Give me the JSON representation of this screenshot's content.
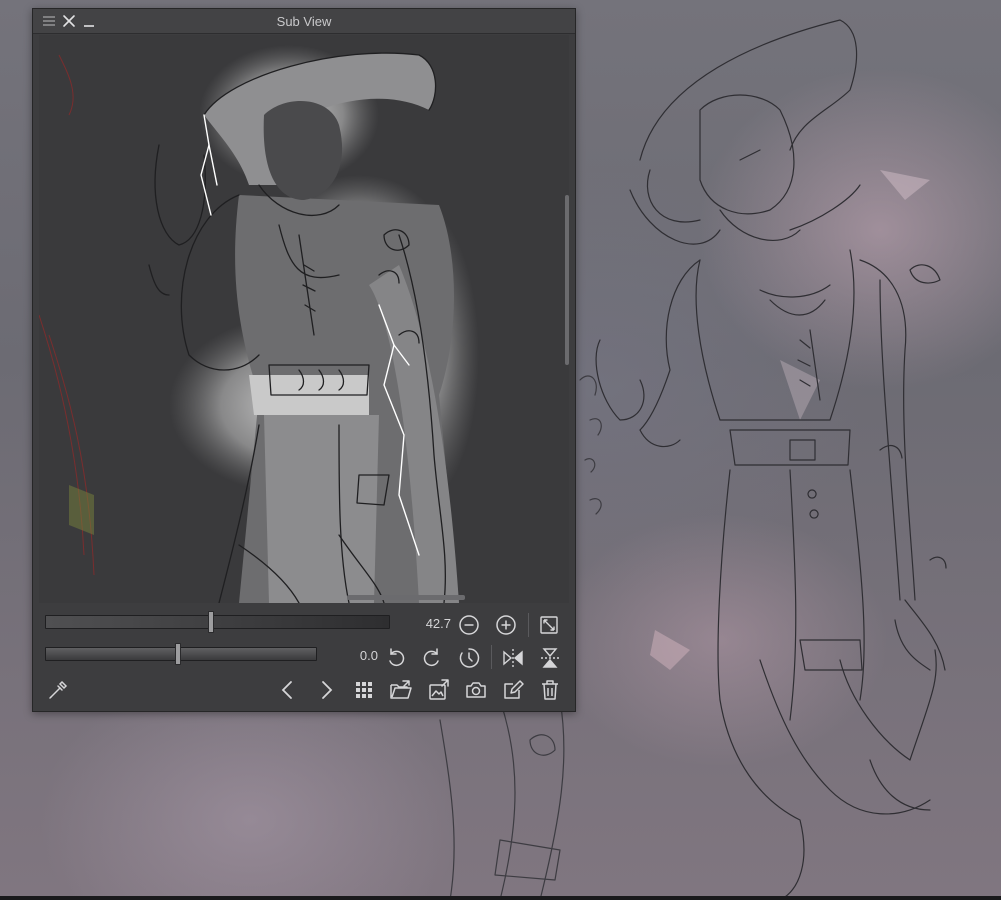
{
  "subview": {
    "title": "Sub View"
  },
  "zoom": {
    "value_label": "42.7",
    "slider_fraction": 0.48
  },
  "rotation": {
    "value_label": "0.0",
    "slider_fraction": 0.49
  },
  "icons": {
    "titlebar": [
      "menu-icon",
      "close-icon",
      "minimize-icon"
    ],
    "zoom_row": [
      "zoom-out-icon",
      "zoom-in-icon",
      "fit-to-window-icon"
    ],
    "rotate_row": [
      "rotate-left-icon",
      "rotate-right-icon",
      "reset-rotation-icon",
      "flip-horizontal-icon",
      "flip-vertical-icon"
    ],
    "bottom_row": [
      "eyedropper-icon",
      "previous-image-icon",
      "next-image-icon",
      "image-list-grid-icon",
      "import-folder-icon",
      "import-image-icon",
      "capture-canvas-icon",
      "edit-image-icon",
      "delete-image-icon"
    ]
  },
  "colors": {
    "panel_bg": "#3d3d3f",
    "icon": "#d6d6d8"
  }
}
